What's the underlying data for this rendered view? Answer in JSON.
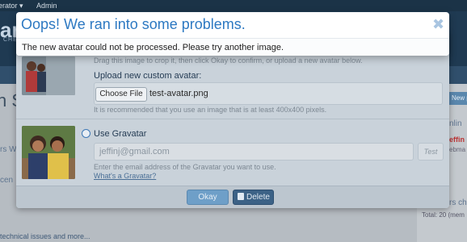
{
  "background": {
    "topbar": {
      "moderator": "erator ▾",
      "admin": "Admin"
    },
    "logo": {
      "text": "an",
      "sub": "CHE"
    },
    "nav": {
      "item": "We",
      "right": "x"
    },
    "page_title": "n Si",
    "section1": "rs W",
    "section2": "cen",
    "footer_link": "technical issues and more...",
    "sidebar": {
      "new_post_button": "New p",
      "online_label": "nlin",
      "online_user": "effin",
      "online_user_sub": "ebma",
      "section": "rs ch",
      "total": "Total: 20 (mem"
    }
  },
  "avatar_editor": {
    "drag_hint": "Drag this image to crop it, then click Okay to confirm, or upload a new avatar below.",
    "upload_label": "Upload new custom avatar:",
    "choose_file_label": "Choose File",
    "file_name": "test-avatar.png",
    "recommendation": "It is recommended that you use an image that is at least 400x400 pixels.",
    "gravatar_label": "Use Gravatar",
    "email_value": "jeffinj@gmail.com",
    "test_button": "Test",
    "email_hint": "Enter the email address of the Gravatar you want to use.",
    "what_gravatar_link": "What's a Gravatar?",
    "okay_button": "Okay",
    "delete_button": "Delete"
  },
  "error_dialog": {
    "title": "Oops! We ran into some problems.",
    "close_icon": "close-icon",
    "message": "The new avatar could not be processed. Please try another image."
  },
  "colors": {
    "error_title": "#2d79c2",
    "okay_button": "#6e9fc8",
    "delete_button": "#3c6286",
    "header": "#1f3a52"
  }
}
